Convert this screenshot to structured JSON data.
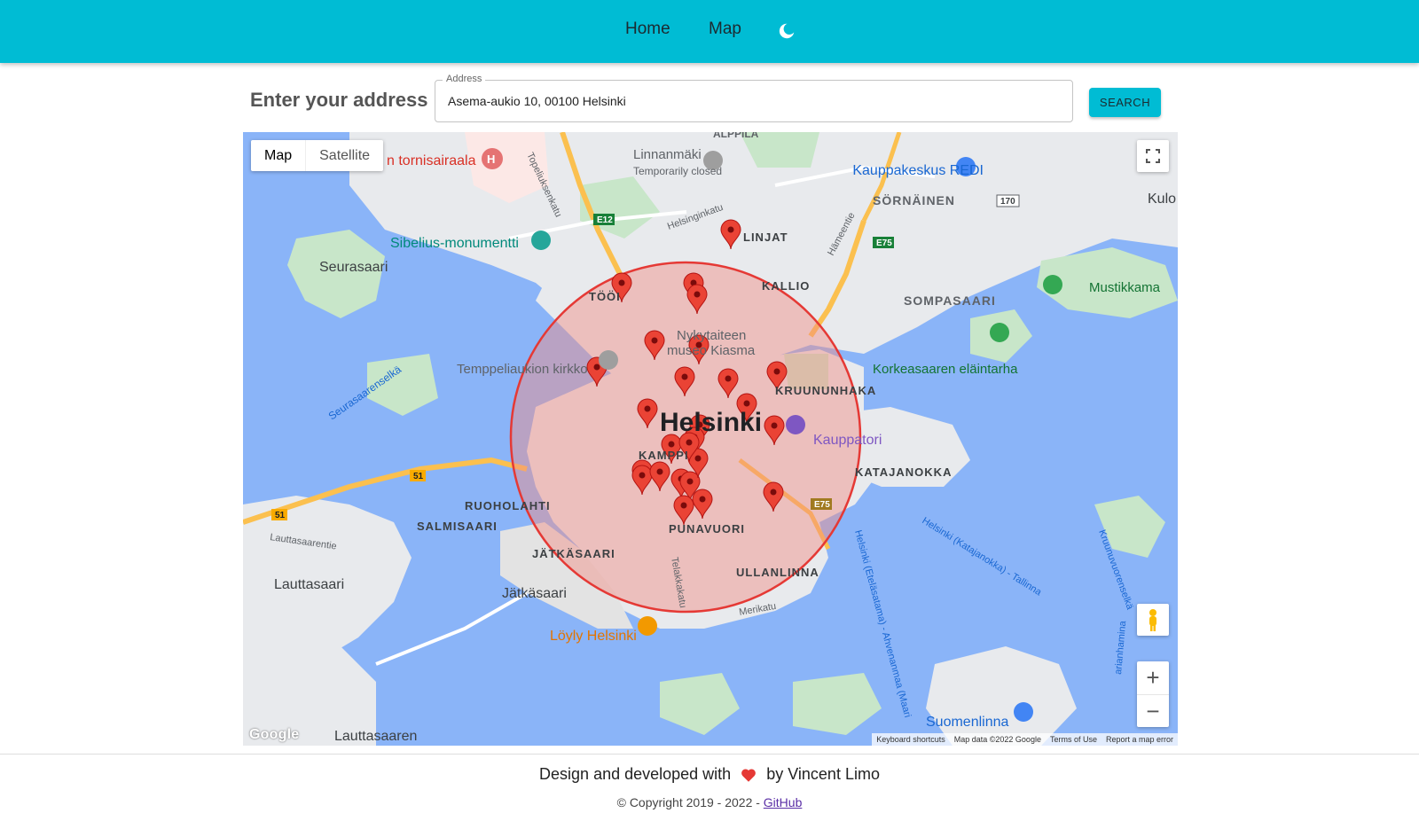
{
  "nav": {
    "home": "Home",
    "map": "Map",
    "theme_icon": "moon-icon"
  },
  "address_section": {
    "title": "Enter your address",
    "field_label": "Address",
    "value": "Asema-aukio 10, 00100 Helsinki",
    "search_button": "SEARCH"
  },
  "map": {
    "type_control": {
      "map": "Map",
      "satellite": "Satellite",
      "selected": "Map"
    },
    "controls": {
      "zoom_in": "+",
      "zoom_out": "−",
      "fullscreen_icon": "fullscreen-icon",
      "pegman_icon": "pegman-icon"
    },
    "attribution": [
      "Keyboard shortcuts",
      "Map data ©2022 Google",
      "Terms of Use",
      "Report a map error"
    ],
    "logo": "Google",
    "circle_color": "#f28b82",
    "circle_stroke": "#e53935",
    "marker_color": "#ea4335",
    "marker_count": 26,
    "labels": {
      "hospital": "n tornisairaala",
      "linnanmaki": "Linnanmäki",
      "linnanmaki_sub": "Temporarily closed",
      "redi": "Kauppakeskus REDI",
      "kulo": "Kulo",
      "alppila": "ALPPILA",
      "sornainen": "SÖRNÄINEN",
      "sibelius": "Sibelius-monumentti",
      "seurasaari": "Seurasaari",
      "linjat": "LINJAT",
      "kallio": "KALLIO",
      "sompasaari": "SOMPASAARI",
      "mustikkamaa": "Mustikkama",
      "toolo": "TÖÖI",
      "kiasma1": "Nykytaiteen",
      "kiasma2": "museo Kiasma",
      "temppeli": "Temppeliaukion kirkko",
      "korkeasaari": "Korkeasaaren eläintarha",
      "kruununhaka": "KRUUNUNHAKA",
      "helsinki": "Helsinki",
      "kauppatori": "Kauppatori",
      "katajanokka": "KATAJANOKKA",
      "kamppi": "KAMPPI",
      "ruoholahti": "RUOHOLAHTI",
      "salmisaari": "SALMISAARI",
      "punavuori": "PUNAVUORI",
      "jatkasaari_caps": "JÄTKÄSAARI",
      "jatkasaari": "Jätkäsaari",
      "ullanlinna": "ULLANLINNA",
      "lauttasaari": "Lauttasaari",
      "lauttasaaren": "Lauttasaaren",
      "loyly": "Löyly Helsinki",
      "suomenlinna": "Suomenlinna",
      "seurasaarenselka": "Seurasaarenselkä",
      "lauttasaarentie": "Lauttasaarentie",
      "topeliuksenkatu": "Topeliuksenkatu",
      "helsinginkatu": "Helsinginkatu",
      "hameentie": "Hämeentie",
      "telakkakatu": "Telakkakatu",
      "merikatu": "Merikatu",
      "ferry1": "Helsinki (Katajanokka) - Tallinna",
      "ferry2": "Helsinki (Eteläsatama) - Ahvenanmaa (Maari",
      "kruunuvuorenselka": "Kruunuvuorenselkä",
      "road_e12": "E12",
      "road_e75a": "E75",
      "road_e75b": "E75",
      "road_51": "51",
      "road_51b": "51",
      "road_170": "170",
      "harmaja": "arianhamina"
    }
  },
  "footer": {
    "credit_before": "Design and developed with",
    "credit_after": "by Vincent Limo",
    "copyright": "© Copyright 2019 - 2022 -",
    "github": "GitHub",
    "heart_color": "#e53935"
  }
}
